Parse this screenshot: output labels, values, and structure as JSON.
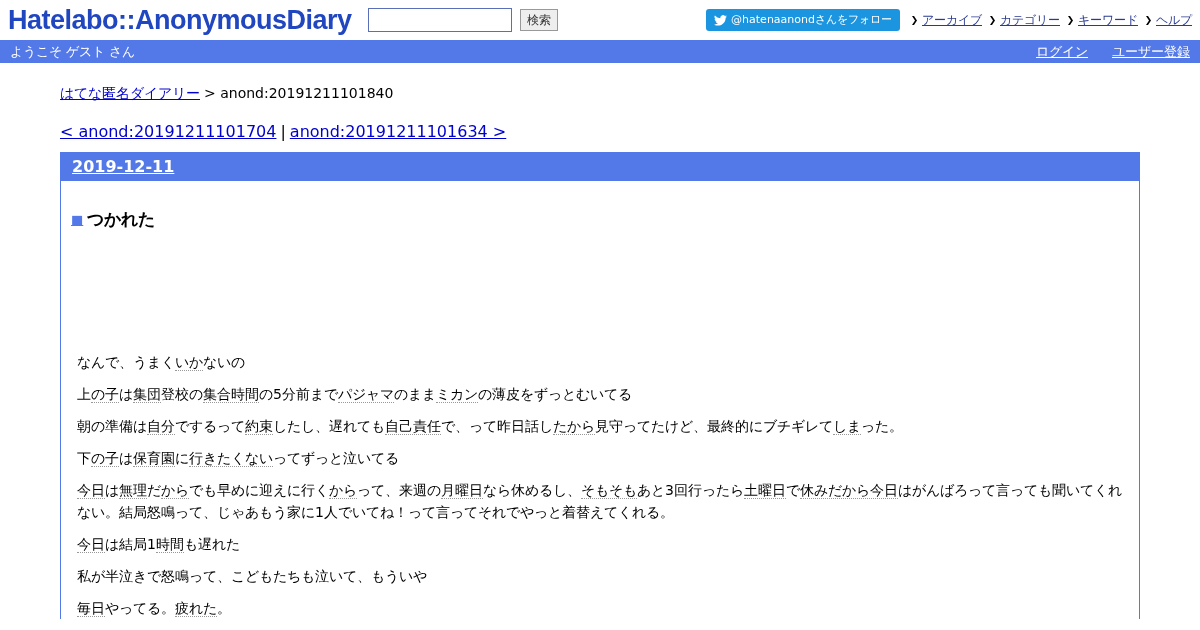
{
  "header": {
    "logo": "Hatelabo::AnonymousDiary",
    "search": {
      "button": "検索"
    },
    "follow_button": "@hatenaanondさんをフォロー",
    "nav_links": [
      "アーカイブ",
      "カテゴリー",
      "キーワード",
      "ヘルプ"
    ]
  },
  "userbar": {
    "greeting": "ようこそ ゲスト さん",
    "links": [
      "ログイン",
      "ユーザー登録"
    ]
  },
  "breadcrumb": {
    "link": "はてな匿名ダイアリー",
    "current": "> anond:20191211101840"
  },
  "pager": {
    "prev": "< anond:20191211101704",
    "separator": "|",
    "next": "anond:20191211101634 >"
  },
  "day": {
    "date": "2019-12-11",
    "title_mark": "■",
    "title": "つかれた",
    "paragraphs": [
      [
        {
          "text": "なんで、うまく",
          "link": false
        },
        {
          "text": "いか",
          "link": true
        },
        {
          "text": "ないの",
          "link": false
        }
      ],
      [
        {
          "text": "上",
          "link": false
        },
        {
          "text": "の子",
          "link": true
        },
        {
          "text": "は",
          "link": false
        },
        {
          "text": "集団",
          "link": true
        },
        {
          "text": "登校の",
          "link": false
        },
        {
          "text": "集合時間",
          "link": true
        },
        {
          "text": "の5分前まで",
          "link": false
        },
        {
          "text": "パジャマ",
          "link": true
        },
        {
          "text": "のまま",
          "link": false
        },
        {
          "text": "ミカン",
          "link": true
        },
        {
          "text": "の薄皮をずっとむいてる",
          "link": false
        }
      ],
      [
        {
          "text": "朝の準備は",
          "link": false
        },
        {
          "text": "自分",
          "link": true
        },
        {
          "text": "でするって",
          "link": false
        },
        {
          "text": "約束",
          "link": true
        },
        {
          "text": "したし、遅れても",
          "link": false
        },
        {
          "text": "自己責任",
          "link": true
        },
        {
          "text": "で、って昨日話し",
          "link": false
        },
        {
          "text": "たから",
          "link": true
        },
        {
          "text": "見守ってたけど、最終的にブチギレて",
          "link": false
        },
        {
          "text": "しま",
          "link": true
        },
        {
          "text": "った。",
          "link": false
        }
      ],
      [
        {
          "text": "下",
          "link": false
        },
        {
          "text": "の子",
          "link": true
        },
        {
          "text": "は",
          "link": false
        },
        {
          "text": "保育園",
          "link": true
        },
        {
          "text": "に",
          "link": false
        },
        {
          "text": "行きたくない",
          "link": true
        },
        {
          "text": "ってずっと泣いてる",
          "link": false
        }
      ],
      [
        {
          "text": "今日",
          "link": true
        },
        {
          "text": "は",
          "link": false
        },
        {
          "text": "無理",
          "link": true
        },
        {
          "text": "だ",
          "link": false
        },
        {
          "text": "から",
          "link": true
        },
        {
          "text": "でも早めに迎えに行く",
          "link": false
        },
        {
          "text": "から",
          "link": true
        },
        {
          "text": "って、来週の",
          "link": false
        },
        {
          "text": "月曜日",
          "link": true
        },
        {
          "text": "なら休めるし、",
          "link": false
        },
        {
          "text": "そもそも",
          "link": true
        },
        {
          "text": "あと3回行ったら",
          "link": false
        },
        {
          "text": "土曜日",
          "link": true
        },
        {
          "text": "で",
          "link": false
        },
        {
          "text": "休みだから今日",
          "link": true
        },
        {
          "text": "はがんばろって言っても聞いてくれない。結局怒鳴って、じゃあもう家に1人でいてね！って言ってそれでやっと着替えてくれる。",
          "link": false
        }
      ],
      [
        {
          "text": "今日",
          "link": true
        },
        {
          "text": "は結局1",
          "link": false
        },
        {
          "text": "時間",
          "link": true
        },
        {
          "text": "も遅れた",
          "link": false
        }
      ],
      [
        {
          "text": "私が半泣きで怒鳴って、こどもたちも泣いて、もういや",
          "link": false
        }
      ],
      [
        {
          "text": "毎日",
          "link": true
        },
        {
          "text": "やってる。",
          "link": false
        },
        {
          "text": "疲れた",
          "link": true
        },
        {
          "text": "。",
          "link": false
        }
      ]
    ]
  }
}
